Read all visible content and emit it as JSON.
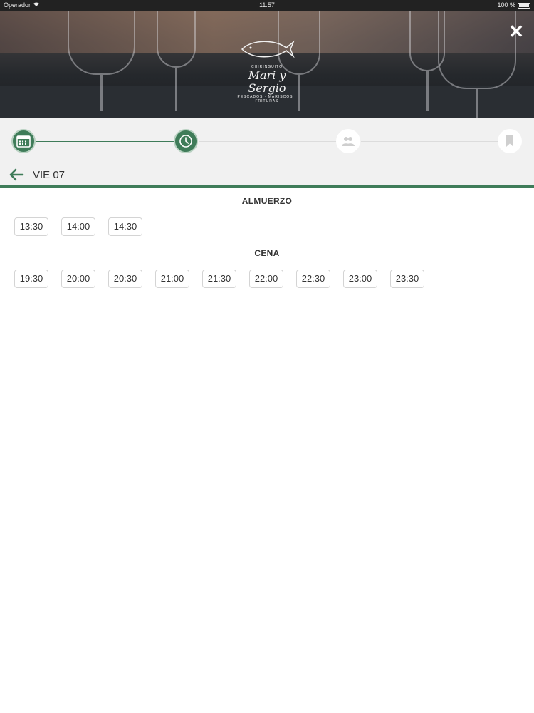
{
  "status_bar": {
    "carrier": "Operador",
    "time": "11:57",
    "battery": "100 %"
  },
  "header": {
    "logo_top": "CHIRINGUITO",
    "logo_name": "Mari y Sergio",
    "logo_sub": "PESCADOS · MARISCOS · FRITURAS",
    "close_label": "✕"
  },
  "steps": [
    {
      "name": "date",
      "icon": "calendar-icon",
      "state": "done"
    },
    {
      "name": "time",
      "icon": "clock-icon",
      "state": "active"
    },
    {
      "name": "people",
      "icon": "people-icon",
      "state": "pending"
    },
    {
      "name": "confirm",
      "icon": "bookmark-icon",
      "state": "pending"
    }
  ],
  "date_label": "VIE 07",
  "lunch": {
    "title": "ALMUERZO",
    "times": [
      "13:30",
      "14:00",
      "14:30"
    ]
  },
  "dinner": {
    "title": "CENA",
    "times": [
      "19:30",
      "20:00",
      "20:30",
      "21:00",
      "21:30",
      "22:00",
      "22:30",
      "23:00",
      "23:30"
    ]
  },
  "colors": {
    "accent": "#3f7c59",
    "step_bg": "#f1f1f1"
  }
}
